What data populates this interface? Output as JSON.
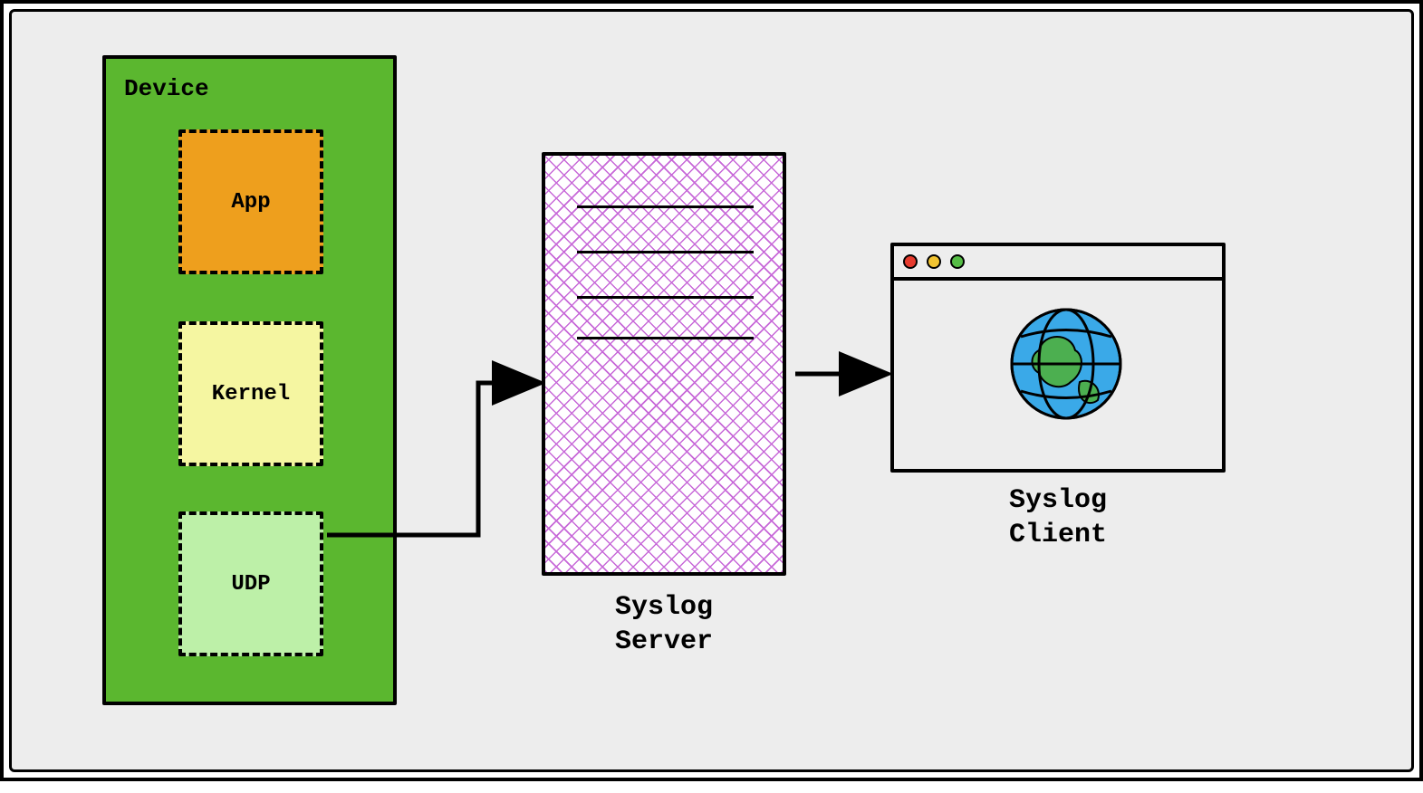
{
  "device": {
    "title": "Device",
    "boxes": {
      "app": {
        "label": "App"
      },
      "kernel": {
        "label": "Kernel"
      },
      "udp": {
        "label": "UDP"
      }
    }
  },
  "server": {
    "label_line1": "Syslog",
    "label_line2": "Server"
  },
  "client": {
    "label_line1": "Syslog",
    "label_line2": "Client"
  },
  "window_dots": {
    "red": "close",
    "yellow": "minimize",
    "green": "zoom"
  }
}
